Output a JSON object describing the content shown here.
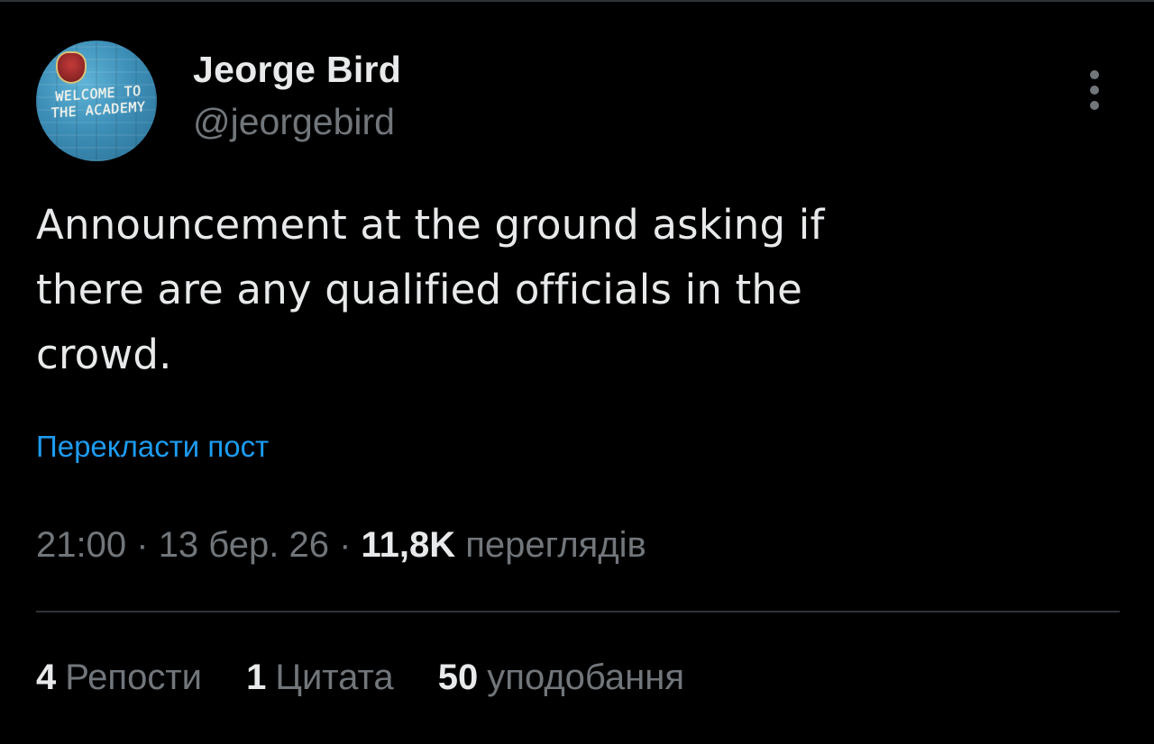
{
  "tweet": {
    "author": {
      "name": "Jeorge Bird",
      "handle": "@jeorgebird",
      "avatar_sign_line1": "WELCOME TO",
      "avatar_sign_line2": "THE ACADEMY"
    },
    "more_icon": "more-vertical-icon",
    "text_lines": [
      "Announcement at the ground asking if",
      "there are any qualified officials in the",
      "crowd."
    ],
    "translate_label": "Перекласти пост",
    "meta": {
      "time": "21:00",
      "separator": "·",
      "date": "13 бер. 26",
      "views_count": "11,8K",
      "views_label": "переглядів"
    },
    "stats": {
      "reposts_count": "4",
      "reposts_label": "Репости",
      "quotes_count": "1",
      "quotes_label": "Цитата",
      "likes_count": "50",
      "likes_label": "уподобання"
    }
  },
  "colors": {
    "background": "#000000",
    "text_primary": "#e7e9ea",
    "text_secondary": "#71767b",
    "link": "#1d9bf0",
    "divider": "#2f3336"
  }
}
